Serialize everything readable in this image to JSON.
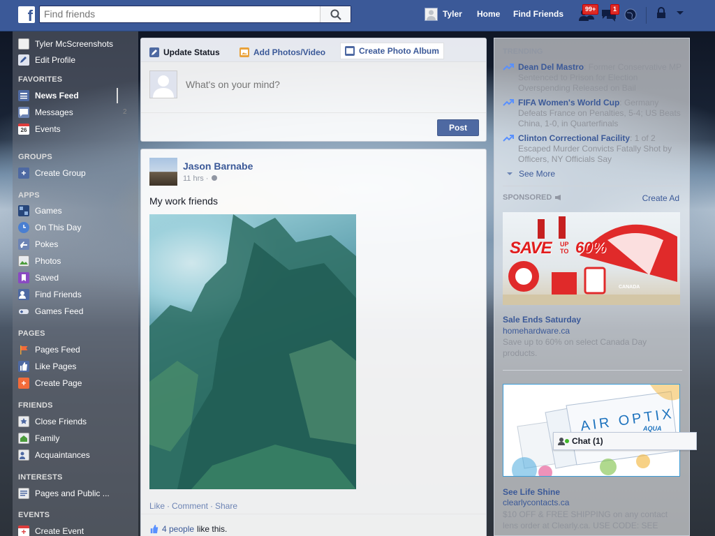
{
  "topbar": {
    "logo": "f",
    "search_placeholder": "Find friends",
    "user_name": "Tyler",
    "home_label": "Home",
    "find_friends_label": "Find Friends",
    "friend_requests_badge": "99+",
    "messages_badge": "1"
  },
  "leftnav": {
    "profile_name": "Tyler McScreenshots",
    "edit_profile": "Edit Profile",
    "favorites_header": "FAVORITES",
    "favorites": [
      {
        "label": "News Feed",
        "icon": "news-feed-icon"
      },
      {
        "label": "Messages",
        "icon": "messages-icon",
        "count": "2"
      },
      {
        "label": "Events",
        "icon": "calendar-icon",
        "icon_text": "26"
      }
    ],
    "groups_header": "GROUPS",
    "groups": [
      {
        "label": "Create Group",
        "icon": "plus-icon"
      }
    ],
    "apps_header": "APPS",
    "apps": [
      {
        "label": "Games",
        "icon": "games-icon"
      },
      {
        "label": "On This Day",
        "icon": "clock-icon"
      },
      {
        "label": "Pokes",
        "icon": "poke-icon"
      },
      {
        "label": "Photos",
        "icon": "photos-icon"
      },
      {
        "label": "Saved",
        "icon": "bookmark-icon"
      },
      {
        "label": "Find Friends",
        "icon": "find-friends-icon"
      },
      {
        "label": "Games Feed",
        "icon": "gamepad-icon"
      }
    ],
    "pages_header": "PAGES",
    "pages": [
      {
        "label": "Pages Feed",
        "icon": "flag-icon"
      },
      {
        "label": "Like Pages",
        "icon": "thumbs-up-icon"
      },
      {
        "label": "Create Page",
        "icon": "plus-icon"
      }
    ],
    "friends_header": "FRIENDS",
    "friends": [
      {
        "label": "Close Friends",
        "icon": "star-list-icon"
      },
      {
        "label": "Family",
        "icon": "family-icon"
      },
      {
        "label": "Acquaintances",
        "icon": "people-icon"
      }
    ],
    "interests_header": "INTERESTS",
    "interests": [
      {
        "label": "Pages and Public ...",
        "icon": "rss-icon"
      }
    ],
    "events_header": "EVENTS",
    "events": [
      {
        "label": "Create Event",
        "icon": "plus-icon"
      }
    ]
  },
  "composer": {
    "tab_status": "Update Status",
    "tab_photos": "Add Photos/Video",
    "tab_album": "Create Photo Album",
    "placeholder": "What's on your mind?",
    "post_button": "Post"
  },
  "post": {
    "author": "Jason Barnabe",
    "time": "11 hrs ·",
    "text": "My work friends",
    "like": "Like",
    "comment": "Comment",
    "share": "Share",
    "likes_count": "4 people",
    "likes_suffix": "like this."
  },
  "trending": {
    "header": "TRENDING",
    "items": [
      {
        "topic": "Dean Del Mastro",
        "rest": ": Former Conservative MP Sentenced to Prison for Election Overspending Released on Bail"
      },
      {
        "topic": "FIFA Women's World Cup",
        "rest": ": Germany Defeats France on Penalties, 5-4; US Beats China, 1-0, in Quarterfinals"
      },
      {
        "topic": "Clinton Correctional Facility",
        "rest": ": 1 of 2 Escaped Murder Convicts Fatally Shot by Officers, NY Officials Say"
      }
    ],
    "see_more": "See More"
  },
  "sponsored": {
    "header": "SPONSORED",
    "create_ad": "Create Ad",
    "ads": [
      {
        "image_text": "SAVE",
        "image_text_upto": "UP TO",
        "image_text_pct": "60%",
        "image_umbrella_text": "CANADA",
        "title": "Sale Ends Saturday",
        "domain": "homehardware.ca",
        "text": "Save up to 60% on select Canada Day products."
      },
      {
        "image_text": "AIR OPTIX",
        "image_text_sub": "AQUA",
        "title": "See Life Shine",
        "domain": "clearlycontacts.ca",
        "text": "$10 OFF & FREE SHIPPING on any contact lens order at Clearly.ca. USE CODE: SEE"
      }
    ]
  },
  "chat": {
    "label": "Chat (1)"
  },
  "colors": {
    "brand": "#3b5998",
    "badge": "#dd2b25",
    "link": "#3b5998"
  }
}
